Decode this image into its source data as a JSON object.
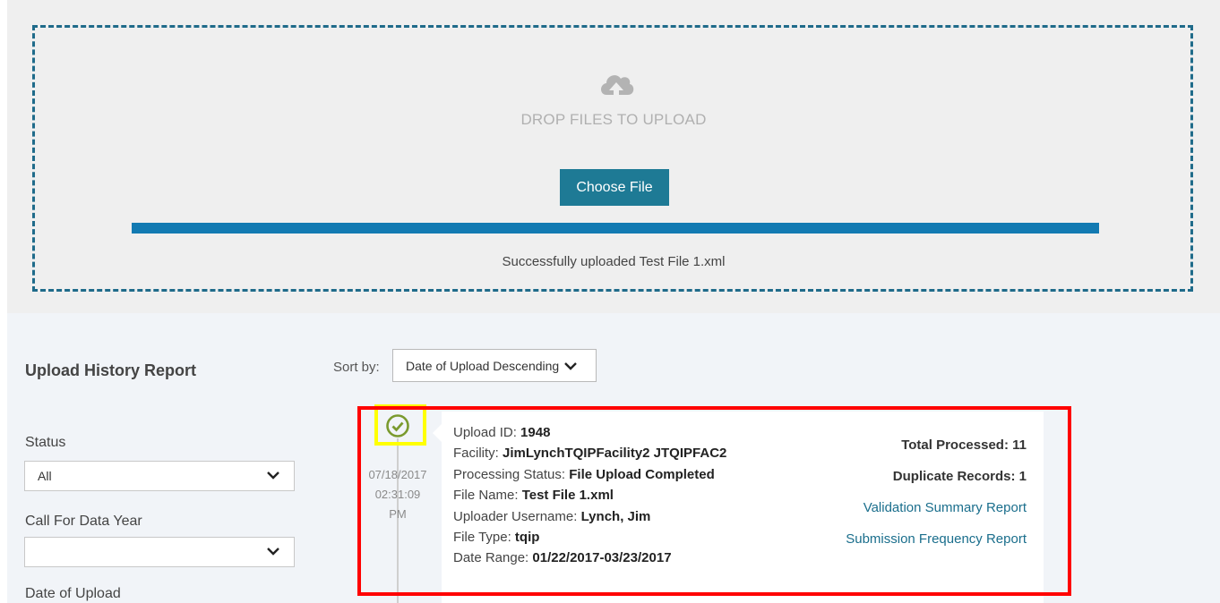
{
  "upload": {
    "drop_text": "DROP FILES TO UPLOAD",
    "choose_label": "Choose File",
    "progress_percent": 100,
    "success_message": "Successfully uploaded Test File 1.xml"
  },
  "report": {
    "title": "Upload History Report",
    "filters": {
      "status_label": "Status",
      "status_value": "All",
      "year_label": "Call For Data Year",
      "year_value": "",
      "date_label": "Date of Upload"
    },
    "sort": {
      "label": "Sort by:",
      "value": "Date of Upload Descending"
    }
  },
  "entry": {
    "status_icon": "check-circle-icon",
    "date": "07/18/2017",
    "time": "02:31:09",
    "ampm": "PM",
    "fields": [
      {
        "label": "Upload ID: ",
        "value": "1948"
      },
      {
        "label": "Facility: ",
        "value": "JimLynchTQIPFacility2 JTQIPFAC2"
      },
      {
        "label": "Processing Status: ",
        "value": "File Upload Completed"
      },
      {
        "label": "File Name: ",
        "value": "Test File 1.xml"
      },
      {
        "label": "Uploader Username: ",
        "value": "Lynch, Jim"
      },
      {
        "label": "File Type: ",
        "value": "tqip"
      },
      {
        "label": "Date Range: ",
        "value": "01/22/2017-03/23/2017"
      }
    ],
    "total_processed": "Total Processed: 11",
    "duplicate_records": "Duplicate Records: 1",
    "validation_link": "Validation Summary Report",
    "frequency_link": "Submission Frequency Report"
  },
  "colors": {
    "accent": "#1e7a95",
    "progress": "#127ab2",
    "success_icon": "#7a9a2e",
    "highlight_yellow": "#ffff00",
    "highlight_red": "#ff0000"
  }
}
